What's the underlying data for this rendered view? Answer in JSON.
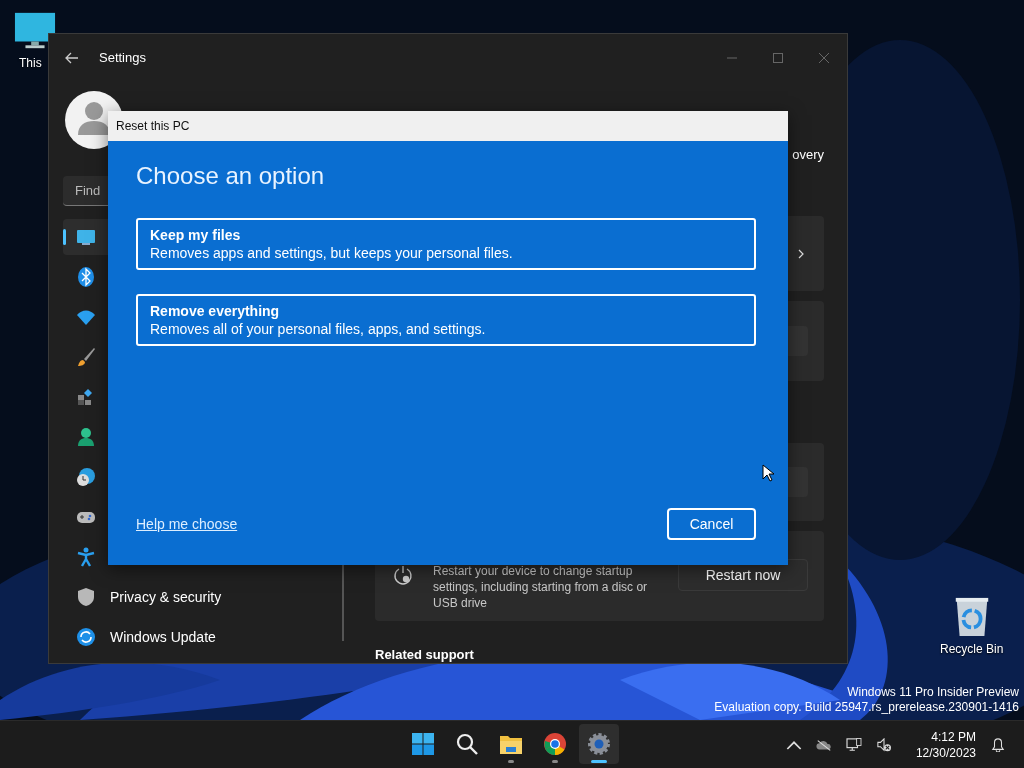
{
  "desktop": {
    "icons": [
      {
        "kind": "monitor",
        "label": "This"
      },
      {
        "kind": "recycle-bin",
        "label": "Recycle Bin"
      }
    ],
    "edition_notice": [
      "Windows 11 Pro Insider Preview",
      "Evaluation copy. Build 25947.rs_prerelease.230901-1416"
    ]
  },
  "settings_window": {
    "title": "Settings",
    "search": {
      "placeholder": "Find"
    },
    "sidebar": {
      "items": [
        {
          "kind": "display",
          "selected": true
        },
        {
          "kind": "bluetooth",
          "selected": false
        },
        {
          "kind": "wifi",
          "selected": false
        },
        {
          "kind": "brush",
          "selected": false
        },
        {
          "kind": "apps",
          "selected": false
        },
        {
          "kind": "person",
          "selected": false
        },
        {
          "kind": "time",
          "selected": false
        },
        {
          "kind": "gamepad",
          "selected": false
        },
        {
          "kind": "accessibility",
          "selected": false
        },
        {
          "kind": "shield",
          "label": "Privacy & security",
          "selected": false
        },
        {
          "kind": "update",
          "label": "Windows Update",
          "selected": false
        }
      ]
    },
    "content": {
      "heading_fragment": "overy",
      "advanced_startup": {
        "description": "Restart your device to change startup settings, including starting from a disc or USB drive",
        "button": "Restart now"
      },
      "related_support": "Related support"
    }
  },
  "dialog": {
    "title": "Reset this PC",
    "heading": "Choose an option",
    "options": [
      {
        "title": "Keep my files",
        "description": "Removes apps and settings, but keeps your personal files."
      },
      {
        "title": "Remove everything",
        "description": "Removes all of your personal files, apps, and settings."
      }
    ],
    "link": "Help me choose",
    "button": "Cancel"
  },
  "taskbar": {
    "apps": [
      {
        "kind": "start",
        "running": false,
        "selected": false
      },
      {
        "kind": "search",
        "running": false,
        "selected": false
      },
      {
        "kind": "folder",
        "running": true,
        "selected": false
      },
      {
        "kind": "browser",
        "running": true,
        "selected": false
      },
      {
        "kind": "gear",
        "running": true,
        "selected": true
      }
    ],
    "tray": {
      "time": "4:12 PM",
      "date": "12/30/2023"
    }
  }
}
